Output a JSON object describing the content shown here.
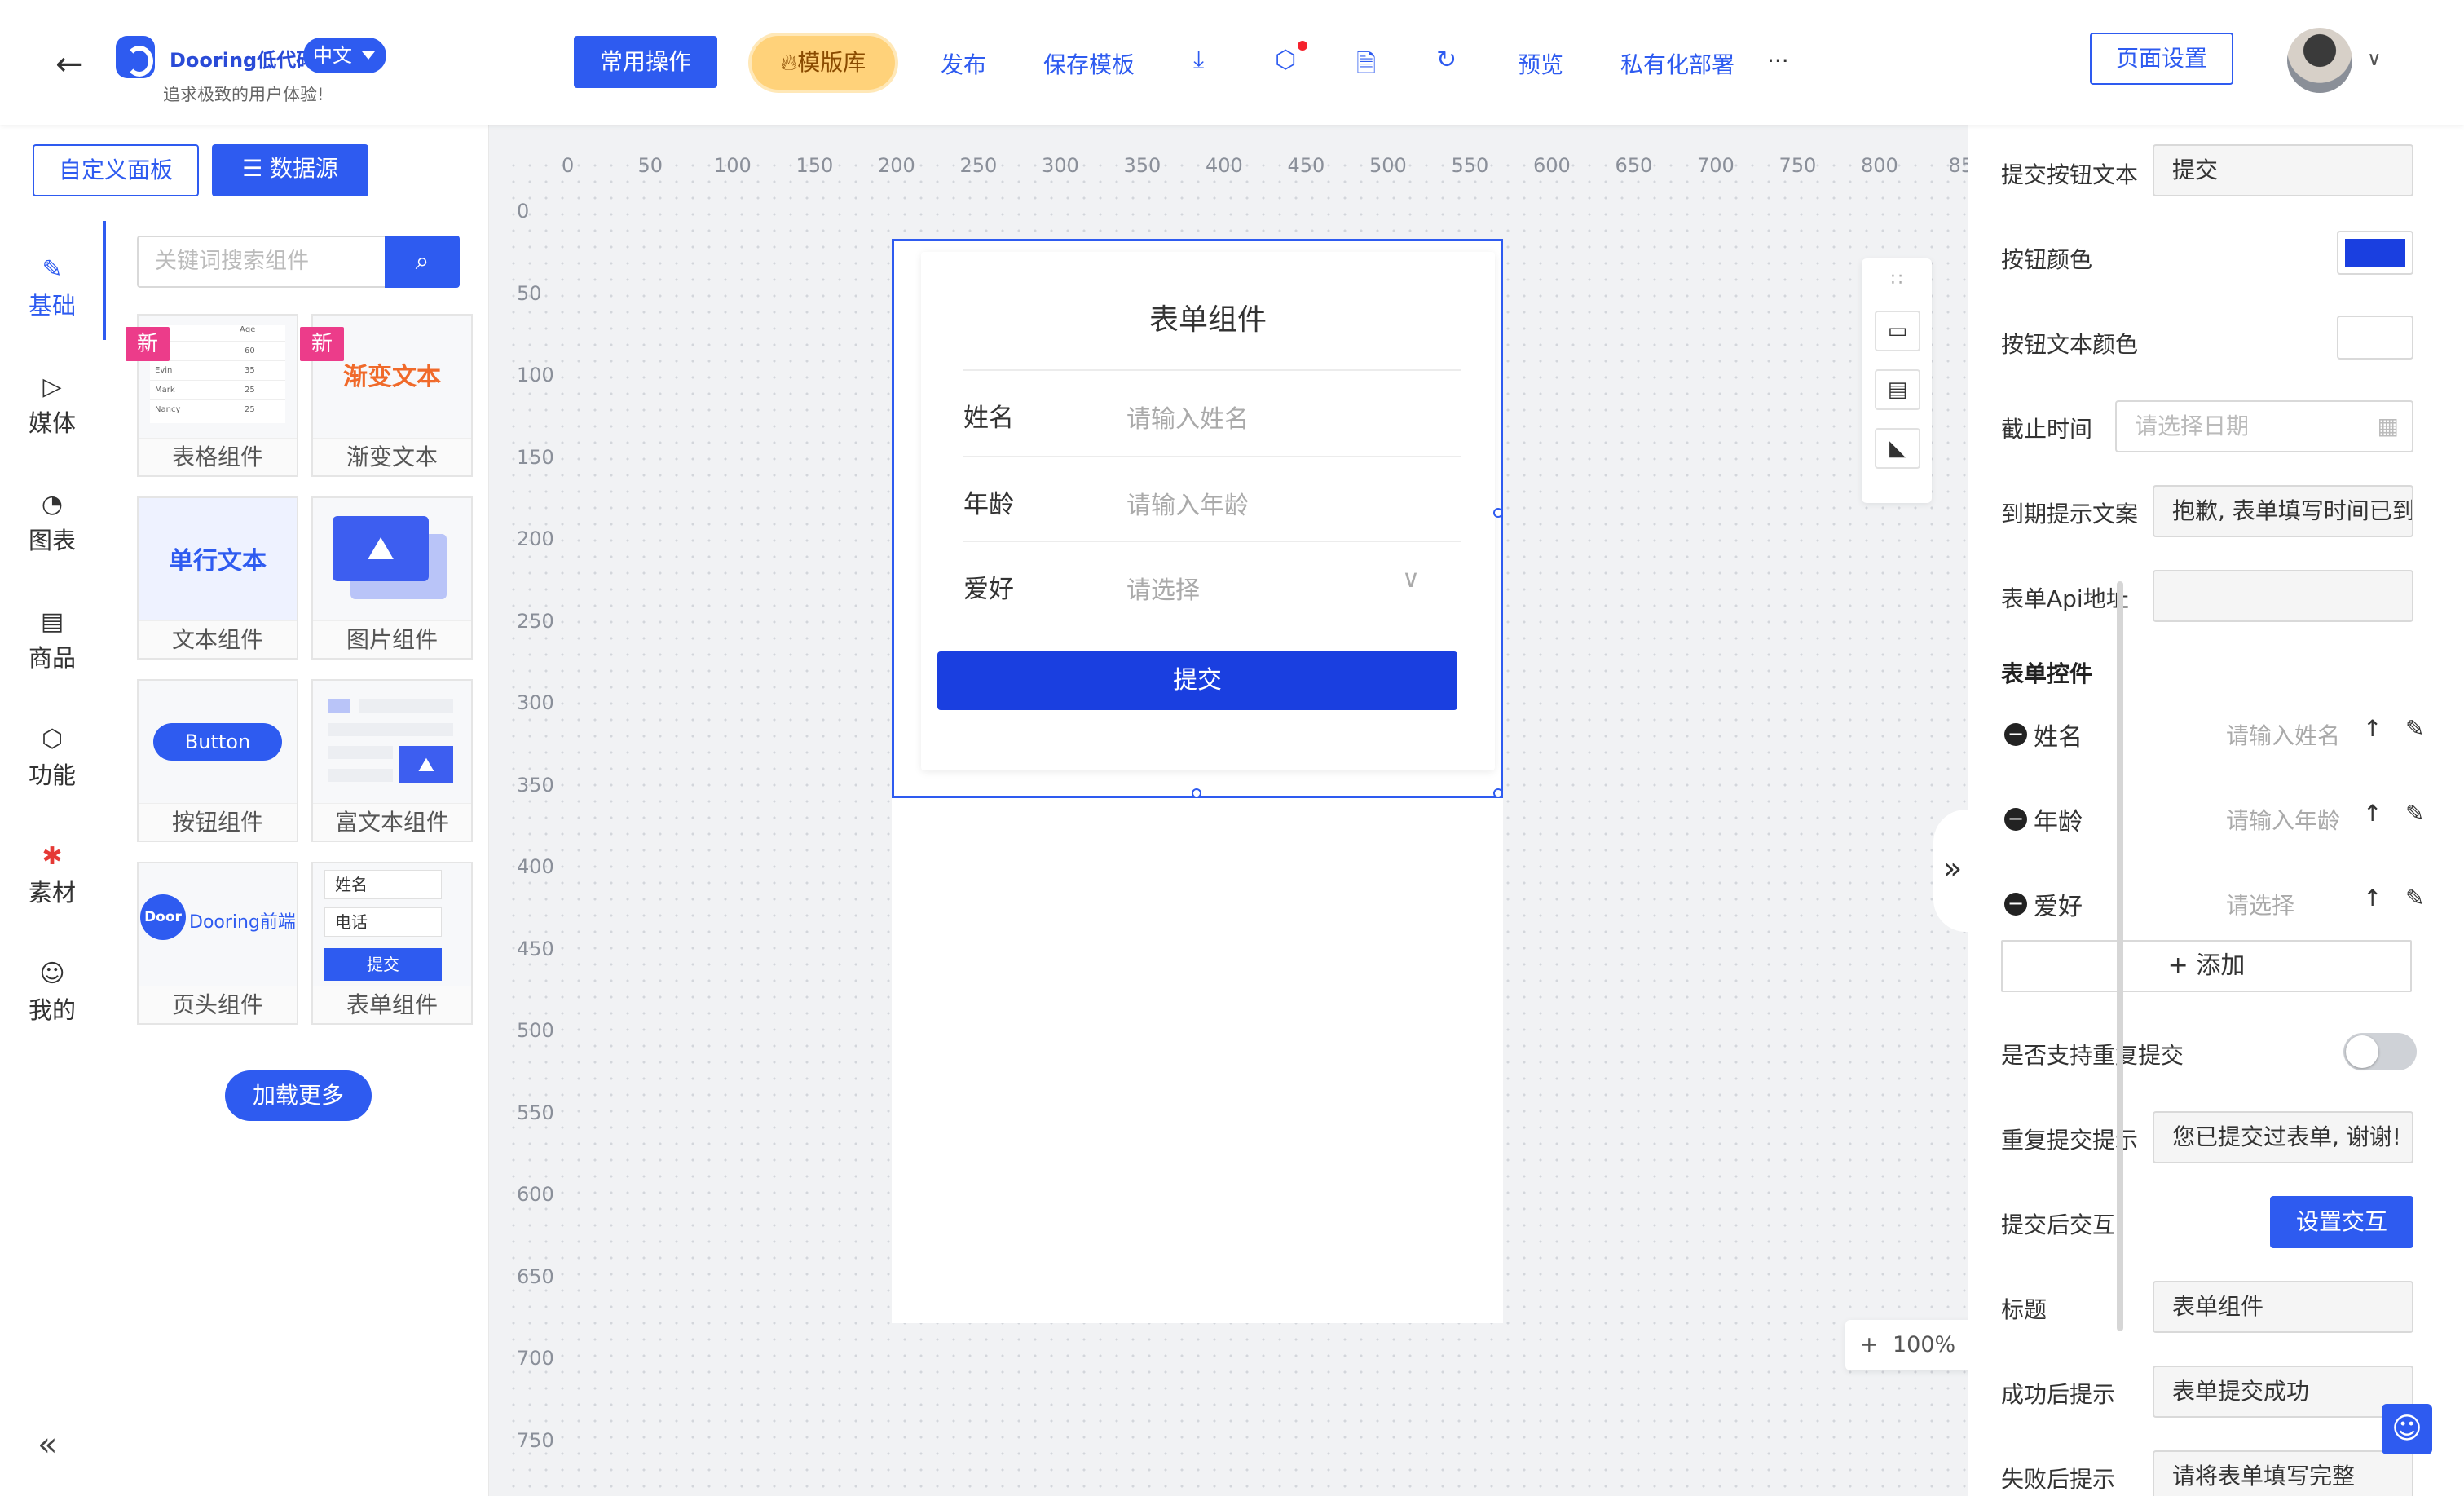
{
  "header": {
    "back_icon": "arrow-left-icon",
    "brand": "Dooring低代码",
    "language": "中文",
    "slogan": "追求极致的用户体验!",
    "common_ops": "常用操作",
    "template_lib": "模版库",
    "publish": "发布",
    "save_template": "保存模板",
    "preview": "预览",
    "private_deploy": "私有化部署",
    "more": "···",
    "page_settings": "页面设置",
    "icons": [
      "download-icon",
      "cube-icon",
      "file-icon",
      "refresh-icon"
    ],
    "accent_color": "#2E5BF0"
  },
  "left": {
    "tab_custom": "自定义面板",
    "tab_data": "数据源",
    "categories": [
      {
        "label": "基础",
        "icon": "brush-icon"
      },
      {
        "label": "媒体",
        "icon": "play-icon"
      },
      {
        "label": "图表",
        "icon": "pie-chart-icon"
      },
      {
        "label": "商品",
        "icon": "shop-icon"
      },
      {
        "label": "功能",
        "icon": "cube-icon"
      },
      {
        "label": "素材",
        "icon": "material-icon"
      },
      {
        "label": "我的",
        "icon": "user-icon"
      }
    ],
    "search_placeholder": "关键词搜索组件",
    "new_tag": "新",
    "components": [
      {
        "label": "表格组件",
        "new": true
      },
      {
        "label": "渐变文本",
        "new": true,
        "thumb_text": "渐变文本"
      },
      {
        "label": "文本组件",
        "thumb_text": "单行文本"
      },
      {
        "label": "图片组件"
      },
      {
        "label": "按钮组件",
        "thumb_text": "Button"
      },
      {
        "label": "富文本组件"
      },
      {
        "label": "页头组件",
        "thumb_text": "Dooring前端",
        "thumb_logo": "Door"
      },
      {
        "label": "表单组件",
        "thumb_rows": [
          "姓名",
          "电话"
        ],
        "thumb_btn": "提交"
      }
    ],
    "table_thumb": {
      "header": "Age",
      "rows": [
        [
          "",
          "60"
        ],
        [
          "Evin",
          "35"
        ],
        [
          "Mark",
          "25"
        ],
        [
          "Nancy",
          "25"
        ]
      ]
    },
    "load_more": "加载更多"
  },
  "canvas": {
    "ruler_x": [
      "0",
      "50",
      "100",
      "150",
      "200",
      "250",
      "300",
      "350",
      "400",
      "450",
      "500",
      "550",
      "600",
      "650",
      "700",
      "750",
      "800",
      "85"
    ],
    "ruler_y": [
      "0",
      "50",
      "100",
      "150",
      "200",
      "250",
      "300",
      "350",
      "400",
      "450",
      "500",
      "550",
      "600",
      "650",
      "700",
      "750"
    ],
    "form": {
      "title": "表单组件",
      "fields": [
        {
          "label": "姓名",
          "placeholder": "请输入姓名"
        },
        {
          "label": "年龄",
          "placeholder": "请输入年龄"
        },
        {
          "label": "爱好",
          "placeholder": "请选择"
        }
      ],
      "submit": "提交"
    },
    "zoom": "100%",
    "zoom_in": "+",
    "zoom_out": "-"
  },
  "right": {
    "submit_text_label": "提交按钮文本",
    "submit_text_value": "提交",
    "btn_color_label": "按钮颜色",
    "btn_color": "#1A3FE0",
    "btn_text_color_label": "按钮文本颜色",
    "deadline_label": "截止时间",
    "deadline_placeholder": "请选择日期",
    "expire_label": "到期提示文案",
    "expire_value": "抱歉, 表单填写时间已到",
    "api_label": "表单Api地址",
    "api_value": "",
    "controls_title": "表单控件",
    "controls": [
      {
        "name": "姓名",
        "placeholder": "请输入姓名"
      },
      {
        "name": "年龄",
        "placeholder": "请输入年龄"
      },
      {
        "name": "爱好",
        "placeholder": "请选择"
      }
    ],
    "add": "+ 添加",
    "repeat_label": "是否支持重复提交",
    "repeat_on": false,
    "repeat_tip_label": "重复提交提示",
    "repeat_tip_value": "您已提交过表单, 谢谢!",
    "after_submit_label": "提交后交互",
    "set_interaction": "设置交互",
    "title_label": "标题",
    "title_value": "表单组件",
    "success_label": "成功后提示",
    "success_value": "表单提交成功",
    "fail_label": "失败后提示",
    "fail_value": "请将表单填写完整"
  }
}
